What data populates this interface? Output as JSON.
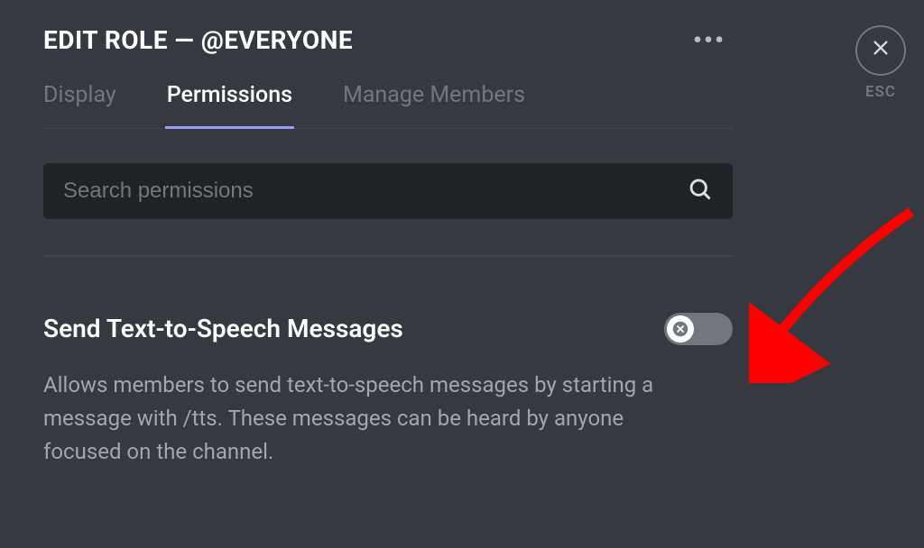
{
  "header": {
    "title": "EDIT ROLE — @EVERYONE",
    "esc_label": "ESC"
  },
  "tabs": {
    "display": "Display",
    "permissions": "Permissions",
    "manage_members": "Manage Members"
  },
  "search": {
    "placeholder": "Search permissions"
  },
  "permission": {
    "title": "Send Text-to-Speech Messages",
    "description": "Allows members to send text-to-speech messages by starting a message with /tts. These messages can be heard by anyone focused on the channel."
  }
}
